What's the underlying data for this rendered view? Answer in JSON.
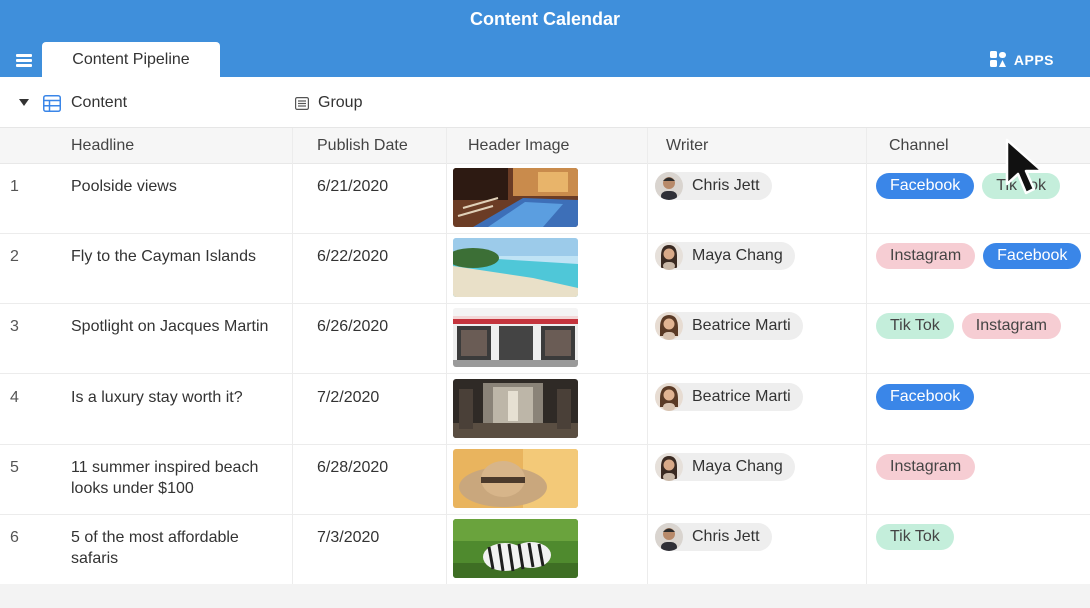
{
  "app": {
    "title": "Content Calendar",
    "apps_label": "APPS"
  },
  "tabs": [
    {
      "label": "Content Pipeline"
    }
  ],
  "view": {
    "name": "Content",
    "group_label": "Group"
  },
  "columns": {
    "headline": "Headline",
    "publish_date": "Publish Date",
    "header_image": "Header Image",
    "writer": "Writer",
    "channel": "Channel"
  },
  "colors": {
    "header_bar": "#3f8fdb",
    "facebook": "#3a86e8",
    "instagram": "#f6cdd3",
    "tiktok": "#c4eedb"
  },
  "rows": [
    {
      "num": "1",
      "headline": "Poolside views",
      "publish_date": "6/21/2020",
      "image": "pool-photo",
      "writer": "Chris Jett",
      "channels": [
        "Facebook",
        "Tik Tok"
      ]
    },
    {
      "num": "2",
      "headline": "Fly to the Cayman Islands",
      "publish_date": "6/22/2020",
      "image": "beach-photo",
      "writer": "Maya Chang",
      "channels": [
        "Instagram",
        "Facebook"
      ]
    },
    {
      "num": "3",
      "headline": "Spotlight on Jacques Martin",
      "publish_date": "6/26/2020",
      "image": "storefront-photo",
      "writer": "Beatrice Marti",
      "channels": [
        "Tik Tok",
        "Instagram"
      ]
    },
    {
      "num": "4",
      "headline": "Is a luxury stay worth it?",
      "publish_date": "7/2/2020",
      "image": "lobby-photo",
      "writer": "Beatrice Marti",
      "channels": [
        "Facebook"
      ]
    },
    {
      "num": "5",
      "headline": "11 summer inspired beach looks under $100",
      "publish_date": "6/28/2020",
      "image": "straw-hat-photo",
      "writer": "Maya Chang",
      "channels": [
        "Instagram"
      ]
    },
    {
      "num": "6",
      "headline": "5 of the most affordable safaris",
      "publish_date": "7/3/2020",
      "image": "zebras-photo",
      "writer": "Chris Jett",
      "channels": [
        "Tik Tok"
      ]
    }
  ]
}
